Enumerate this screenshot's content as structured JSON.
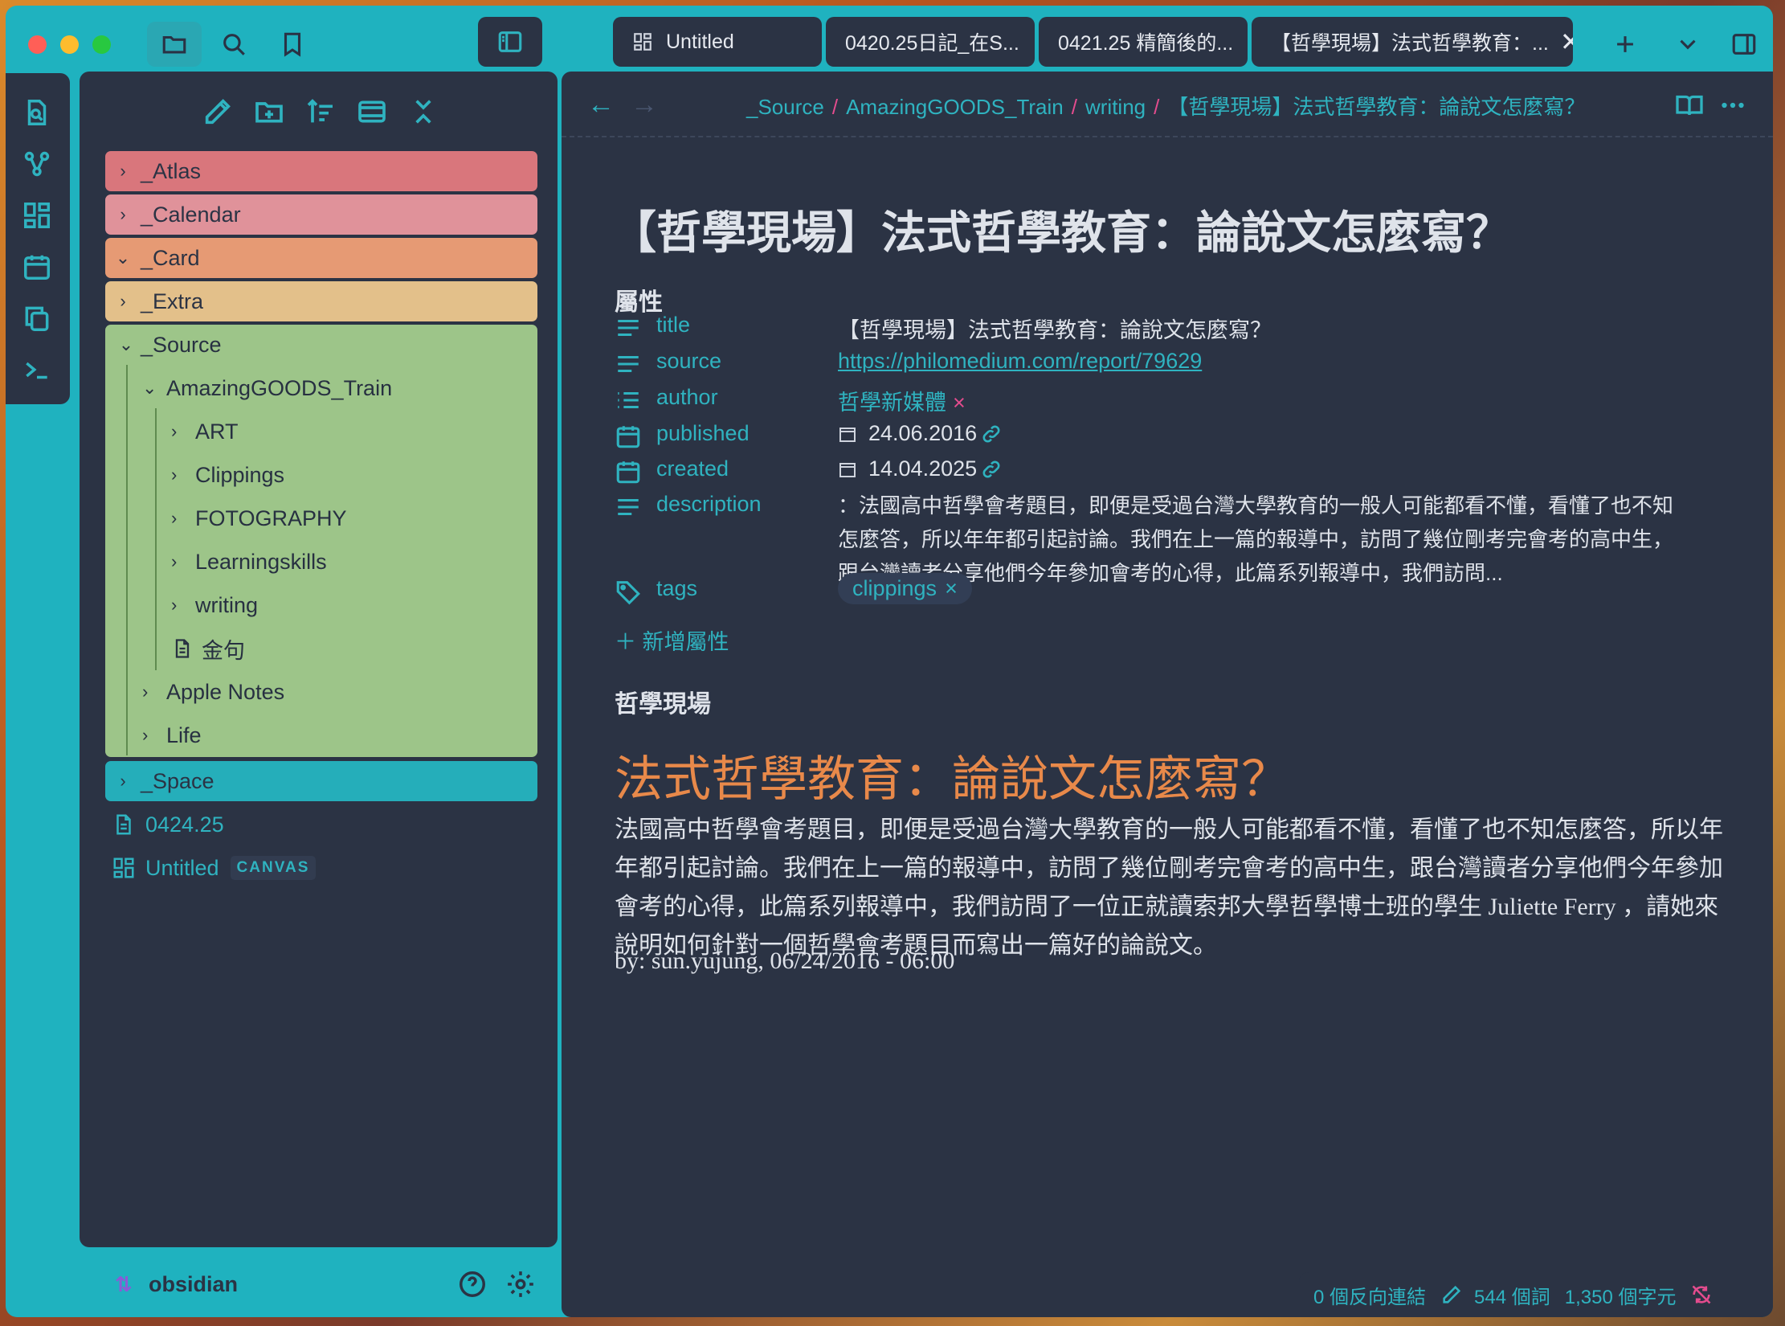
{
  "app": {
    "name": "Obsidian",
    "accent": "#1fb2bf",
    "panel_bg": "#2b3344"
  },
  "tabs": [
    {
      "label": "Untitled",
      "icon": "canvas-icon"
    },
    {
      "label": "0420.25日記_在S..."
    },
    {
      "label": "0421.25 精簡後的..."
    },
    {
      "label": "【哲學現場】法式哲學教育：...",
      "active": true
    }
  ],
  "sidebar": {
    "folders": [
      {
        "label": "_Atlas",
        "expanded": false,
        "color": "#d9767c"
      },
      {
        "label": "_Calendar",
        "expanded": false,
        "color": "#e0929a"
      },
      {
        "label": "_Card",
        "expanded": true,
        "color": "#e69a74"
      },
      {
        "label": "_Extra",
        "expanded": false,
        "color": "#e3c08a"
      },
      {
        "label": "_Source",
        "expanded": true,
        "color": "#9dc589"
      },
      {
        "label": "_Space",
        "expanded": false,
        "color": "#25aeba"
      }
    ],
    "source_children": {
      "amazing": "AmazingGOODS_Train",
      "amazing_children": [
        "ART",
        "Clippings",
        "FOTOGRAPHY",
        "Learningskills",
        "writing"
      ],
      "file_jinju": "金句",
      "apple_notes": "Apple Notes",
      "life": "Life"
    },
    "root_files": [
      {
        "label": "0424.25",
        "icon": "file-icon"
      },
      {
        "label": "Untitled",
        "icon": "canvas-icon",
        "badge": "CANVAS"
      }
    ],
    "vault_name": "obsidian"
  },
  "breadcrumb": [
    "_Source",
    "AmazingGOODS_Train",
    "writing",
    "【哲學現場】法式哲學教育：論說文怎麼寫？"
  ],
  "note": {
    "title": "【哲學現場】法式哲學教育：論說文怎麼寫？",
    "properties_heading": "屬性",
    "properties": {
      "title_key": "title",
      "title_val": "【哲學現場】法式哲學教育：論說文怎麼寫？",
      "source_key": "source",
      "source_val": "https://philomedium.com/report/79629",
      "author_key": "author",
      "author_val": "哲學新媒體",
      "published_key": "published",
      "published_val": "24.06.2016",
      "created_key": "created",
      "created_val": "14.04.2025",
      "description_key": "description",
      "description_val": "：法國高中哲學會考題目，即便是受過台灣大學教育的一般人可能都看不懂，看懂了也不知怎麼答，所以年年都引起討論。我們在上一篇的報導中，訪問了幾位剛考完會考的高中生，跟台灣讀者分享他們今年參加會考的心得，此篇系列報導中，我們訪問...",
      "tags_key": "tags",
      "tags_val": "clippings"
    },
    "add_property": "新增屬性",
    "section_heading": "哲學現場",
    "article_heading": "法式哲學教育：論說文怎麼寫？",
    "article_paragraph": "法國高中哲學會考題目，即便是受過台灣大學教育的一般人可能都看不懂，看懂了也不知怎麼答，所以年年都引起討論。我們在上一篇的報導中，訪問了幾位剛考完會考的高中生，跟台灣讀者分享他們今年參加會考的心得，此篇系列報導中，我們訪問了一位正就讀索邦大學哲學博士班的學生 Juliette Ferry ，請她來說明如何針對一個哲學會考題目而寫出一篇好的論說文。",
    "byline": "by: sun.yujung, 06/24/2016 - 06:00"
  },
  "status": {
    "backlinks": "0 個反向連結",
    "words": "544 個詞",
    "chars": "1,350 個字元"
  }
}
